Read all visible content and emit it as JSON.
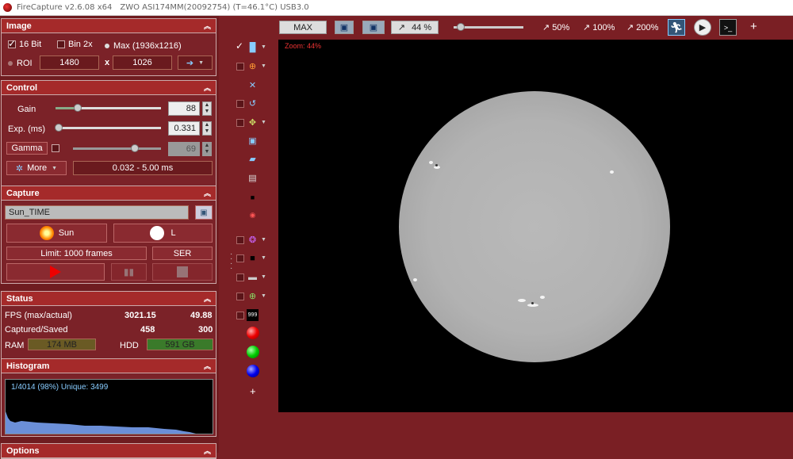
{
  "titlebar": {
    "app": "FireCapture v2.6.08  x64",
    "camera": "ZWO ASI174MM(20092754) (T=46.1°C) USB3.0"
  },
  "image": {
    "title": "Image",
    "bit16": "16 Bit",
    "bin": "Bin 2x",
    "max": "Max (1936x1216)",
    "roi": "ROI",
    "roi_w": "1480",
    "x": "x",
    "roi_h": "1026"
  },
  "control": {
    "title": "Control",
    "gain_label": "Gain",
    "gain_value": "88",
    "gain_level": 0.21,
    "exp_label": "Exp. (ms)",
    "exp_value": "0.331",
    "exp_level": 0.0,
    "gamma_label": "Gamma",
    "gamma_value": "69",
    "gamma_level": 0.7,
    "more": "More",
    "range": "0.032 - 5.00 ms"
  },
  "capture": {
    "title": "Capture",
    "name": "Sun_TIME",
    "profile": "Sun",
    "filter": "L",
    "limit": "Limit: 1000 frames",
    "format": "SER"
  },
  "status": {
    "title": "Status",
    "fps_label": "FPS (max/actual)",
    "fps_max": "3021.15",
    "fps_actual": "49.88",
    "captured_label": "Captured/Saved",
    "captured": "458",
    "saved": "300",
    "ram_label": "RAM",
    "ram": "174 MB",
    "hdd_label": "HDD",
    "hdd": "591 GB"
  },
  "histogram": {
    "title": "Histogram",
    "info": "1/4014 (98%)  Unique: 3499"
  },
  "options": {
    "title": "Options"
  },
  "topbar": {
    "max": "MAX",
    "zoom": "44 %",
    "z50": "50%",
    "z100": "100%",
    "z200": "200%",
    "plus": "+"
  },
  "viewer": {
    "zoom_label": "Zoom: 44%"
  },
  "tools": {
    "plus": "+"
  }
}
